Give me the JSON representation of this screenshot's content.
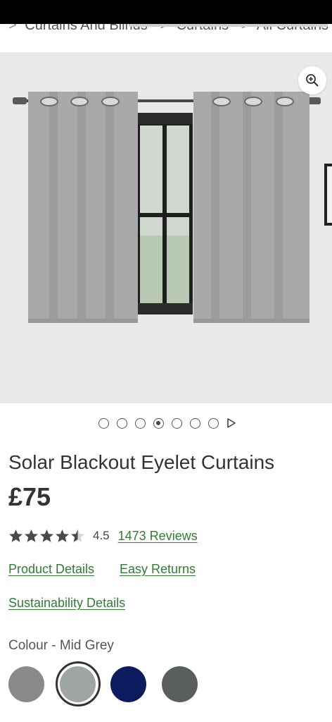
{
  "breadcrumb": {
    "items": [
      "Curtains And Blinds",
      "Curtains",
      "All Curtains"
    ],
    "separator": ">"
  },
  "gallery": {
    "zoom_icon": "zoom-in-icon",
    "image_count": 7,
    "active_index": 4
  },
  "pager": {
    "next_icon": "play-next-icon"
  },
  "product": {
    "title": "Solar Blackout Eyelet Curtains",
    "price": "£75",
    "rating_value": "4.5",
    "rating": 4.5,
    "rating_max": 5,
    "reviews_label": "1473 Reviews"
  },
  "links": {
    "product_details": "Product Details",
    "easy_returns": "Easy Returns",
    "sustainability": "Sustainability Details"
  },
  "colour": {
    "label": "Colour - Mid Grey",
    "swatches": [
      {
        "name": "Grey",
        "color": "#8a8a8a"
      },
      {
        "name": "Mid Grey",
        "color": "#9fa5a1",
        "selected": true
      },
      {
        "name": "Navy",
        "color": "#0c1a5e"
      },
      {
        "name": "Charcoal",
        "color": "#5b5f5c"
      }
    ]
  },
  "colors": {
    "accent_link": "#2e7d32",
    "text": "#333333",
    "curtain": "#a9a9ab",
    "wall": "#e9e9ea"
  }
}
